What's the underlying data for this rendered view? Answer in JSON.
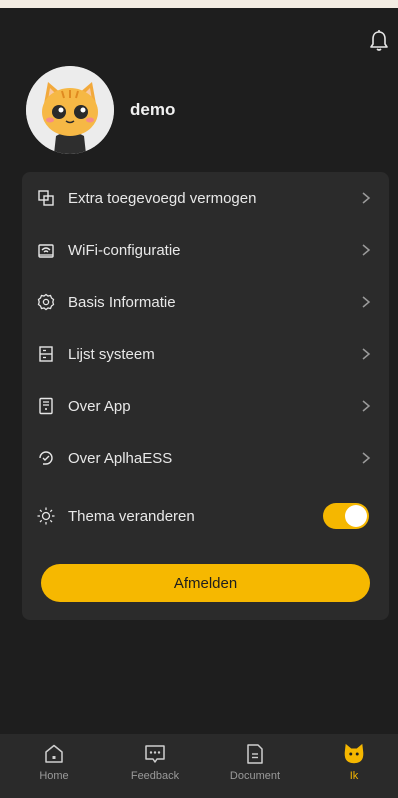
{
  "colors": {
    "accent": "#f5b700",
    "background": "#1e1e1e",
    "card": "#2b2b2b",
    "tabbar": "#2a2a2a"
  },
  "header": {
    "notification_icon": "bell-icon"
  },
  "profile": {
    "username": "demo",
    "avatar_icon": "cat-avatar-icon"
  },
  "menu": {
    "items": [
      {
        "label": "Extra toegevoegd vermogen",
        "icon": "extra-power-icon"
      },
      {
        "label": "WiFi-configuratie",
        "icon": "wifi-device-icon"
      },
      {
        "label": "Basis Informatie",
        "icon": "gear-icon"
      },
      {
        "label": "Lijst systeem",
        "icon": "list-system-icon"
      },
      {
        "label": "Over App",
        "icon": "about-app-icon"
      },
      {
        "label": "Over AplhaESS",
        "icon": "about-company-icon"
      }
    ],
    "theme": {
      "label": "Thema veranderen",
      "icon": "sun-icon",
      "enabled": true
    },
    "logout_label": "Afmelden"
  },
  "tabbar": {
    "tabs": [
      {
        "label": "Home",
        "icon": "home-icon"
      },
      {
        "label": "Feedback",
        "icon": "chat-icon"
      },
      {
        "label": "Document",
        "icon": "document-icon"
      },
      {
        "label": "Ik",
        "icon": "cat-face-icon",
        "active": true
      }
    ]
  }
}
